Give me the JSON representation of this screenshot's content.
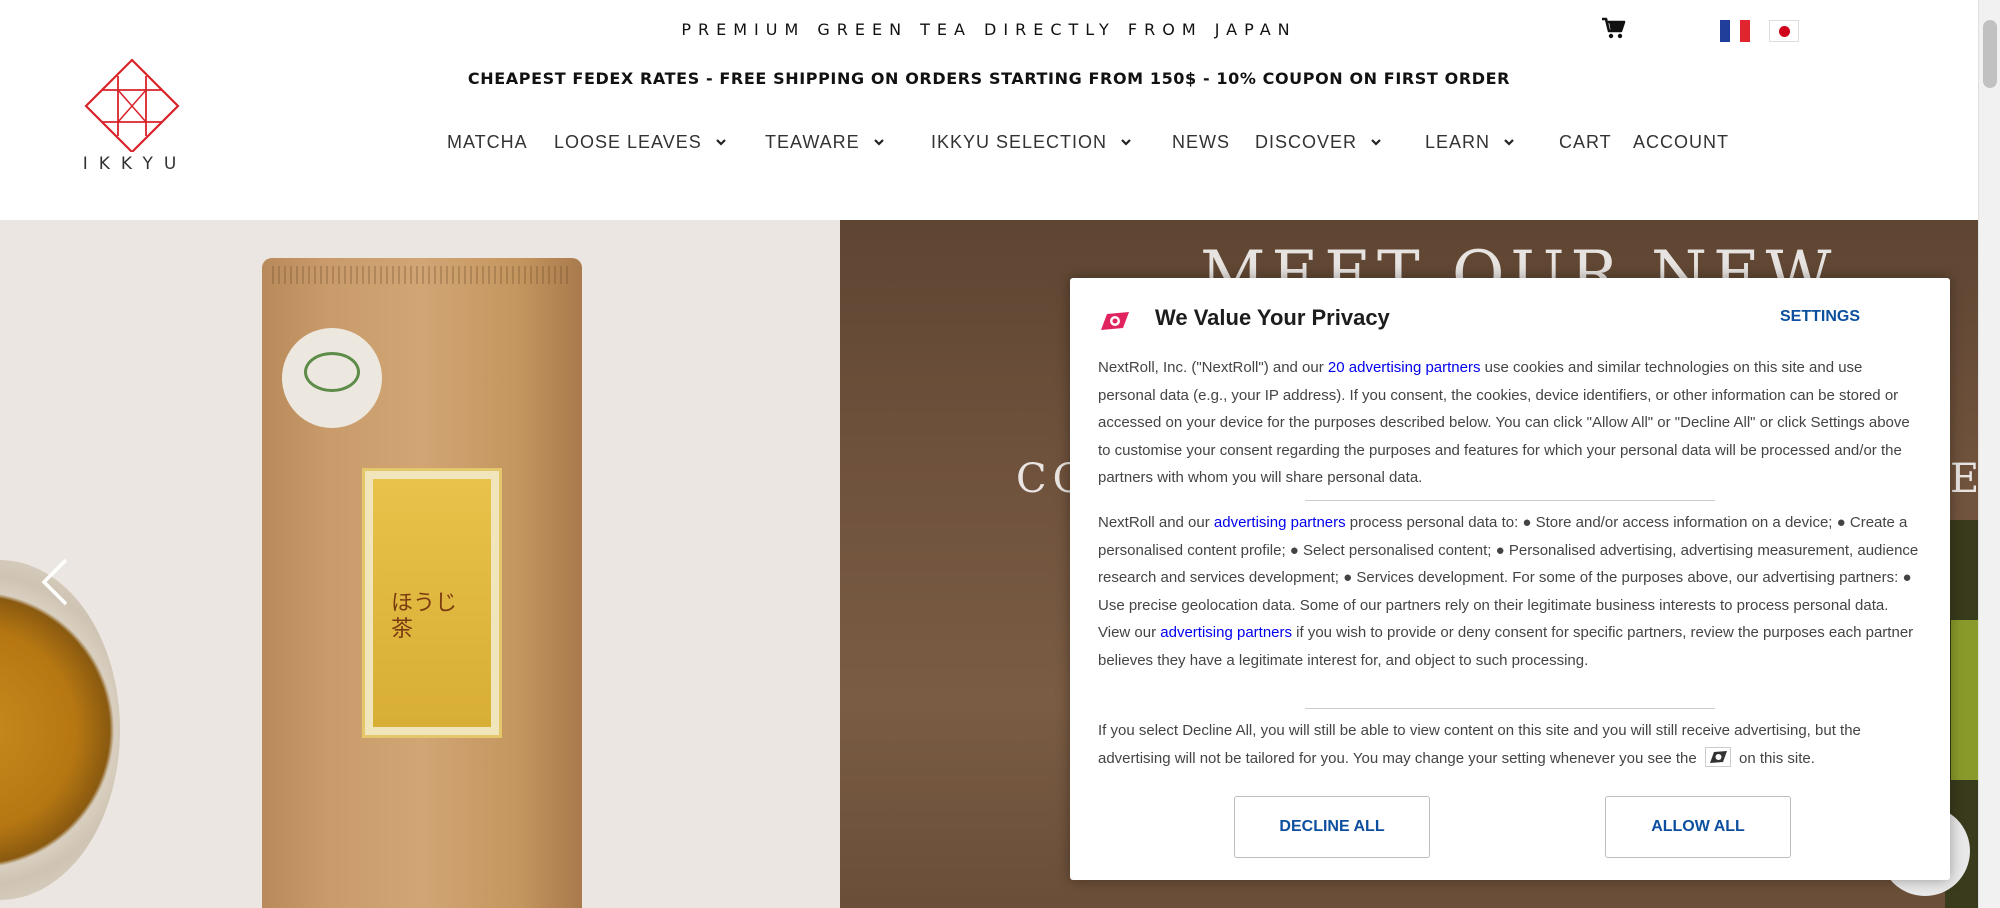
{
  "header": {
    "tagline": "PREMIUM GREEN TEA DIRECTLY FROM JAPAN",
    "promo": "CHEAPEST FEDEX RATES - FREE SHIPPING ON ORDERS STARTING FROM 150$ - 10% COUPON ON FIRST ORDER",
    "logo_text": "IKKYU",
    "languages": [
      "French",
      "Japanese"
    ]
  },
  "nav": {
    "items": [
      {
        "label": "MATCHA",
        "dropdown": false
      },
      {
        "label": "LOOSE LEAVES",
        "dropdown": true
      },
      {
        "label": "TEAWARE",
        "dropdown": true
      },
      {
        "label": "IKKYU SELECTION",
        "dropdown": true
      },
      {
        "label": "NEWS",
        "dropdown": false
      },
      {
        "label": "DISCOVER",
        "dropdown": true
      },
      {
        "label": "LEARN",
        "dropdown": true
      },
      {
        "label": "CART",
        "dropdown": false
      },
      {
        "label": "ACCOUNT",
        "dropdown": false
      }
    ]
  },
  "hero": {
    "title_visible": "MEET OUR NEW",
    "sub_left": "CO",
    "sub_right": "E",
    "product_label": "ほうじ茶"
  },
  "dialog": {
    "title": "We Value Your Privacy",
    "settings": "SETTINGS",
    "p1": {
      "before": "NextRoll, Inc. (\"NextRoll\") and our ",
      "link": "20 advertising partners",
      "after": " use cookies and similar technologies on this site and use personal data (e.g., your IP address). If you consent, the cookies, device identifiers, or other information can be stored or accessed on your device for the purposes described below. You can click \"Allow All\" or \"Decline All\" or click Settings above to customise your consent regarding the purposes and features for which your personal data will be processed and/or the partners with whom you will share personal data."
    },
    "p2": {
      "before": "NextRoll and our ",
      "link1": "advertising partners",
      "middle": " process personal data to: ● Store and/or access information on a device; ● Create a personalised content profile; ● Select personalised content; ● Personalised advertising, advertising measurement, audience research and services development; ● Services development. For some of the purposes above, our advertising partners: ● Use precise geolocation data. Some of our partners rely on their legitimate business interests to process personal data. View our ",
      "link2": "advertising partners",
      "after": " if you wish to provide or deny consent for specific partners, review the purposes each partner believes they have a legitimate interest for, and object to such processing."
    },
    "p3": {
      "before": "If you select Decline All, you will still be able to view content on this site and you will still receive advertising, but the advertising will not be tailored for you. You may change your setting whenever you see the ",
      "after": " on this site."
    },
    "decline": "DECLINE ALL",
    "allow": "ALLOW ALL"
  },
  "colors": {
    "logo_red": "#d8232a",
    "link_blue": "#0000ee",
    "button_blue": "#0b4f9e",
    "hero_brown": "#6f523c"
  }
}
